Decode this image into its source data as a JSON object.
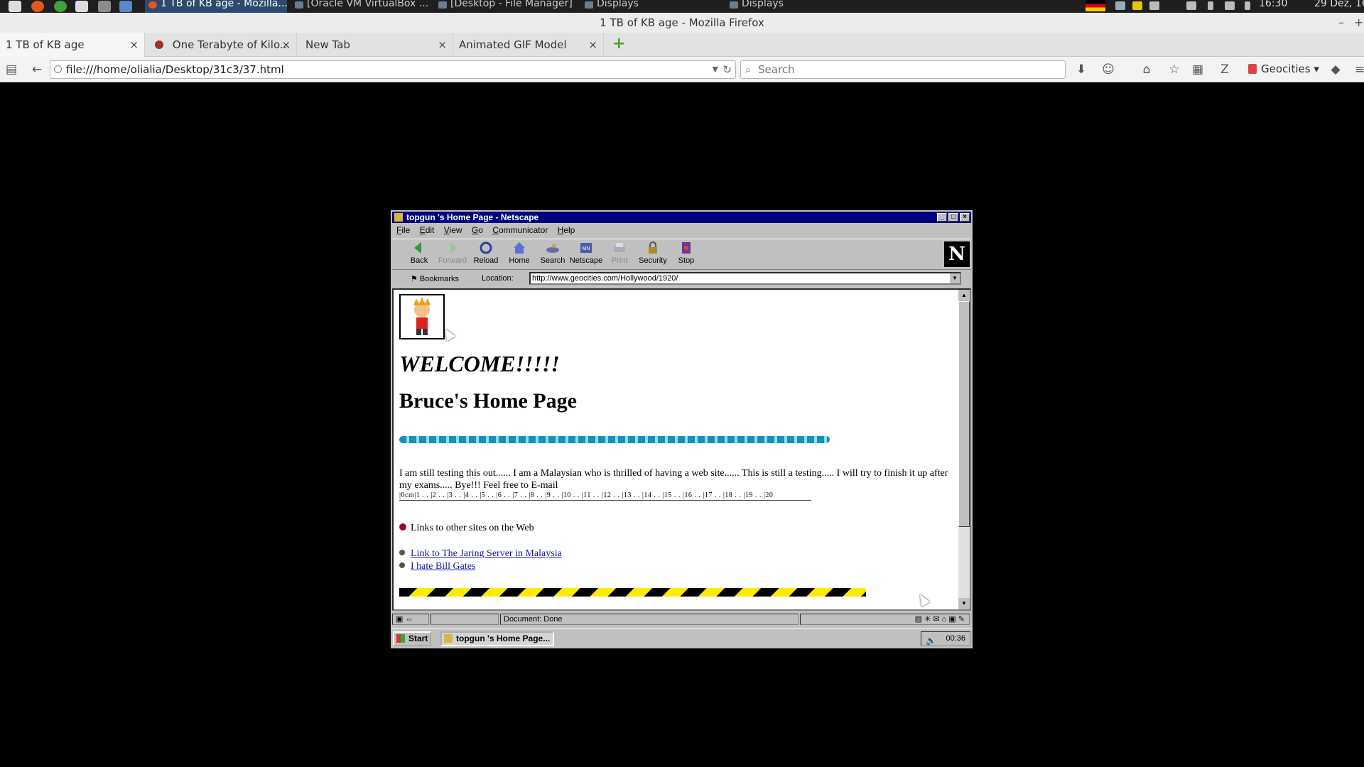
{
  "os_panel": {
    "tasks": [
      "1 TB of KB age - Mozilla...",
      "[Oracle VM VirtualBox ...",
      "[Desktop - File Manager]",
      "Displays",
      "Displays"
    ],
    "clock": "16:30",
    "date": "29 Dez, 16"
  },
  "firefox": {
    "window_title": "1 TB of KB age - Mozilla Firefox",
    "tabs": [
      {
        "label": "1 TB of KB age",
        "close": "×"
      },
      {
        "label": "One Terabyte of Kilo...",
        "close": "×"
      },
      {
        "label": "New Tab",
        "close": "×"
      },
      {
        "label": "Animated GIF Model",
        "close": "×"
      }
    ],
    "url": "file:///home/olialia/Desktop/31c3/37.html",
    "search_placeholder": "Search",
    "bookmark_menu_label": "Geocities"
  },
  "netscape": {
    "title": "topgun 's Home Page - Netscape",
    "menu": [
      "File",
      "Edit",
      "View",
      "Go",
      "Communicator",
      "Help"
    ],
    "toolbar": [
      {
        "label": "Back",
        "icon": "back-arrow-icon",
        "enabled": true
      },
      {
        "label": "Forward",
        "icon": "forward-arrow-icon",
        "enabled": false
      },
      {
        "label": "Reload",
        "icon": "reload-icon",
        "enabled": true
      },
      {
        "label": "Home",
        "icon": "home-icon",
        "enabled": true
      },
      {
        "label": "Search",
        "icon": "search-icon",
        "enabled": true
      },
      {
        "label": "Netscape",
        "icon": "netscape-icon",
        "enabled": true
      },
      {
        "label": "Print",
        "icon": "print-icon",
        "enabled": false
      },
      {
        "label": "Security",
        "icon": "security-lock-icon",
        "enabled": true
      },
      {
        "label": "Stop",
        "icon": "stop-icon",
        "enabled": true
      }
    ],
    "bookmarks_label": "Bookmarks",
    "location_label": "Location:",
    "location_url": "http://www.geocities.com/Hollywood/1920/",
    "page": {
      "welcome": "WELCOME!!!!!",
      "heading": "Bruce's Home Page",
      "intro": "I am still testing this out...... I am a Malaysian who is thrilled of having a web site...... This is still a testing..... I will try to finish it up after my exams..... Bye!!! Feel free to E-mail",
      "ruler": "|0cm|1 . . |2 . . |3 . . |4 . . |5 . . |6 . . |7 . . |8 . . |9 . . |10 . . |11 . . |12 . . |13 . . |14 . . |15 . . |16 . . |17 . . |18 . . |19 . . |20",
      "links_heading": "Links to other sites on the Web",
      "links": [
        "Link to The Jaring Server in Malaysia",
        "I hate Bill Gates"
      ]
    },
    "status": "Document: Done",
    "taskbar": {
      "start": "Start",
      "task": "topgun 's Home Page...",
      "clock": "00:36"
    }
  }
}
